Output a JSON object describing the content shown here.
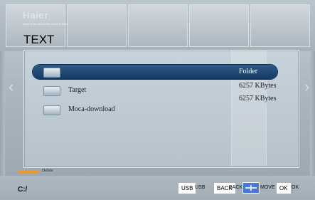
{
  "header": {
    "brand": "Haier",
    "tagline": "haier of the world, the world of haier",
    "title": "TEXT"
  },
  "list": {
    "items": [
      {
        "name": "",
        "col2": "Folder",
        "selected": true
      },
      {
        "name": "Target",
        "col2": "6257 KBytes",
        "selected": false
      },
      {
        "name": "Moca-download",
        "col2": "6257 KBytes",
        "selected": false
      }
    ]
  },
  "hints": {
    "delete": "Delete"
  },
  "footer": {
    "path": "C:/",
    "usb_key": "USB",
    "usb_label": "USB",
    "back_key": "BACK",
    "back_label": "BACK",
    "move_label": "MOVE",
    "ok_key": "OK",
    "ok_label": "OK"
  },
  "icons": {
    "left_arrow": "chevron-left-icon",
    "right_arrow": "chevron-right-icon",
    "folder": "folder-icon",
    "move": "dpad-icon"
  },
  "colors": {
    "selection": "#1b426d",
    "delete_key": "#f09a2a",
    "move_key": "#4a78d6"
  }
}
